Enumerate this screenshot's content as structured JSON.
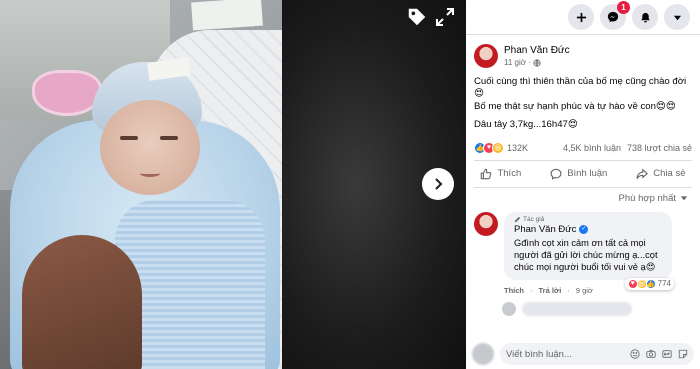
{
  "viewer": {
    "tag_icon": "tag-icon",
    "expand_icon": "expand-icon",
    "next_icon": "chevron-right-icon"
  },
  "topbar": {
    "buttons": [
      "plus-icon",
      "messenger-icon",
      "bell-icon",
      "caret-down-icon"
    ],
    "messenger_badge": "1"
  },
  "post": {
    "author": "Phan Văn Đức",
    "time": "11 giờ",
    "privacy_icon": "globe-icon",
    "lines": [
      "Cuối cùng thì thiên thần của bố mẹ cũng chào đời😍",
      "Bố mẹ thật sự hạnh phúc và tự hào về con😍😍",
      "Dâu tây 3,7kg...16h47😍"
    ],
    "reactions_count": "132K",
    "comments_count": "4,5K bình luận",
    "shares_count": "738 lượt chia sẻ",
    "reaction_colors": {
      "like": "#1877f2",
      "love": "#f33e58",
      "haha": "#f7b928"
    }
  },
  "actions": {
    "like": "Thích",
    "comment": "Bình luận",
    "share": "Chia sẻ"
  },
  "sort_label": "Phù hợp nhất",
  "comment": {
    "role": "Tác giả",
    "author": "Phan Văn Đức",
    "text": "Gđình cọt xin cảm ơn tất cả mọi người đã gửi lời chúc mừng ạ...cọt chúc mọi người buổi tối vui vẻ ạ😍",
    "reaction_count": "774",
    "like_label": "Thích",
    "reply_label": "Trả lời",
    "time": "9 giờ"
  },
  "compose": {
    "placeholder": "Viết bình luận...",
    "icons": [
      "emoji-icon",
      "camera-icon",
      "gif-icon",
      "sticker-icon"
    ]
  },
  "colors": {
    "accent": "#1877f2",
    "badge": "#e41e3f"
  }
}
